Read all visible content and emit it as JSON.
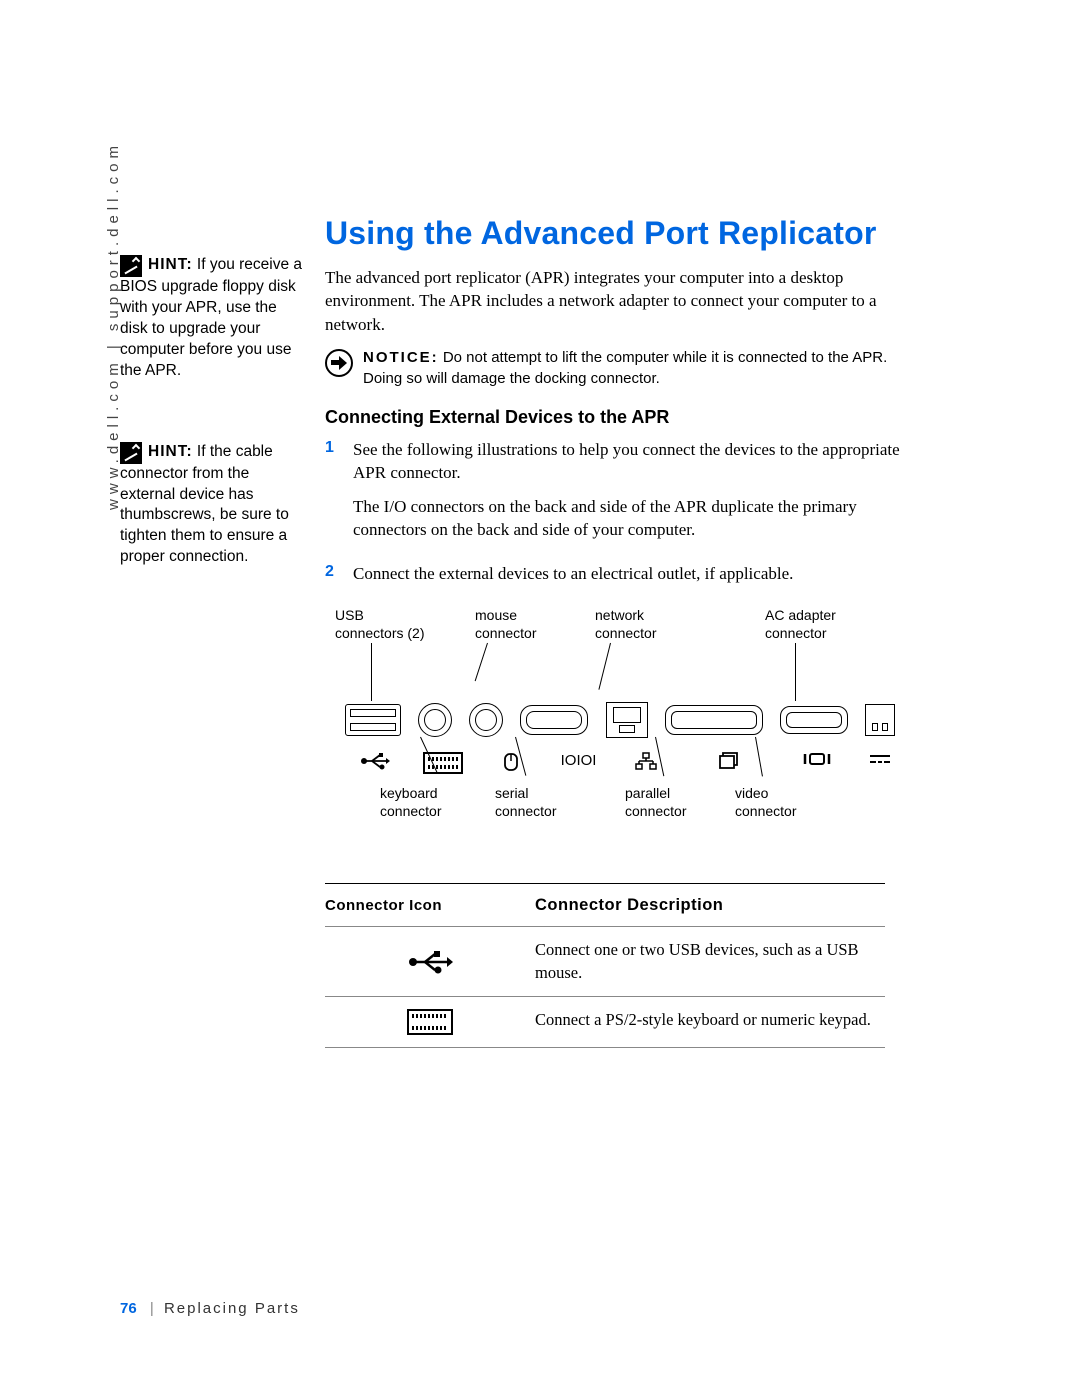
{
  "vurl": "www.dell.com | support.dell.com",
  "sidebar": {
    "hints": [
      {
        "label": "HINT:",
        "text": "If you receive a BIOS upgrade floppy disk with your APR, use the disk to upgrade your computer before you use the APR."
      },
      {
        "label": "HINT:",
        "text": "If the cable connector from the external device has thumbscrews, be sure to tighten them to ensure a proper connection."
      }
    ]
  },
  "main": {
    "title": "Using the Advanced Port Replicator",
    "intro": "The advanced port replicator (APR) integrates your computer into a desktop environment. The APR includes a network adapter to connect your computer to a network.",
    "notice": {
      "label": "NOTICE:",
      "text": "Do not attempt to lift the computer while it is connected to the APR. Doing so will damage the docking connector."
    },
    "subheading": "Connecting External Devices to the APR",
    "steps": [
      {
        "num": "1",
        "p1": "See the following illustrations to help you connect the devices to the appropriate APR connector.",
        "p2": "The I/O connectors on the back and side of the APR duplicate the primary connectors on the back and side of your computer."
      },
      {
        "num": "2",
        "p1": "Connect the external devices to an electrical outlet, if applicable."
      }
    ],
    "diagram": {
      "top_labels": {
        "usb": "USB\nconnectors (2)",
        "mouse": "mouse\nconnector",
        "network": "network\nconnector",
        "ac": "AC adapter\nconnector"
      },
      "bottom_labels": {
        "keyboard": "keyboard\nconnector",
        "serial": "serial\nconnector",
        "parallel": "parallel\nconnector",
        "video": "video\nconnector"
      },
      "symbols": {
        "usb": "⬩←",
        "keyboard": "▭",
        "mouse": "🖱",
        "serial": "IOIOI",
        "network": "ᴰᴰ",
        "parallel": "▭",
        "video": "I▭I",
        "ac": "⎓"
      }
    },
    "table": {
      "h1": "Connector Icon",
      "h2": "Connector Description",
      "rows": [
        {
          "icon": "usb",
          "desc": "Connect one or two USB devices, such as a USB mouse."
        },
        {
          "icon": "keyboard",
          "desc": "Connect a PS/2-style keyboard or numeric keypad."
        }
      ]
    }
  },
  "footer": {
    "page": "76",
    "section": "Replacing Parts"
  }
}
